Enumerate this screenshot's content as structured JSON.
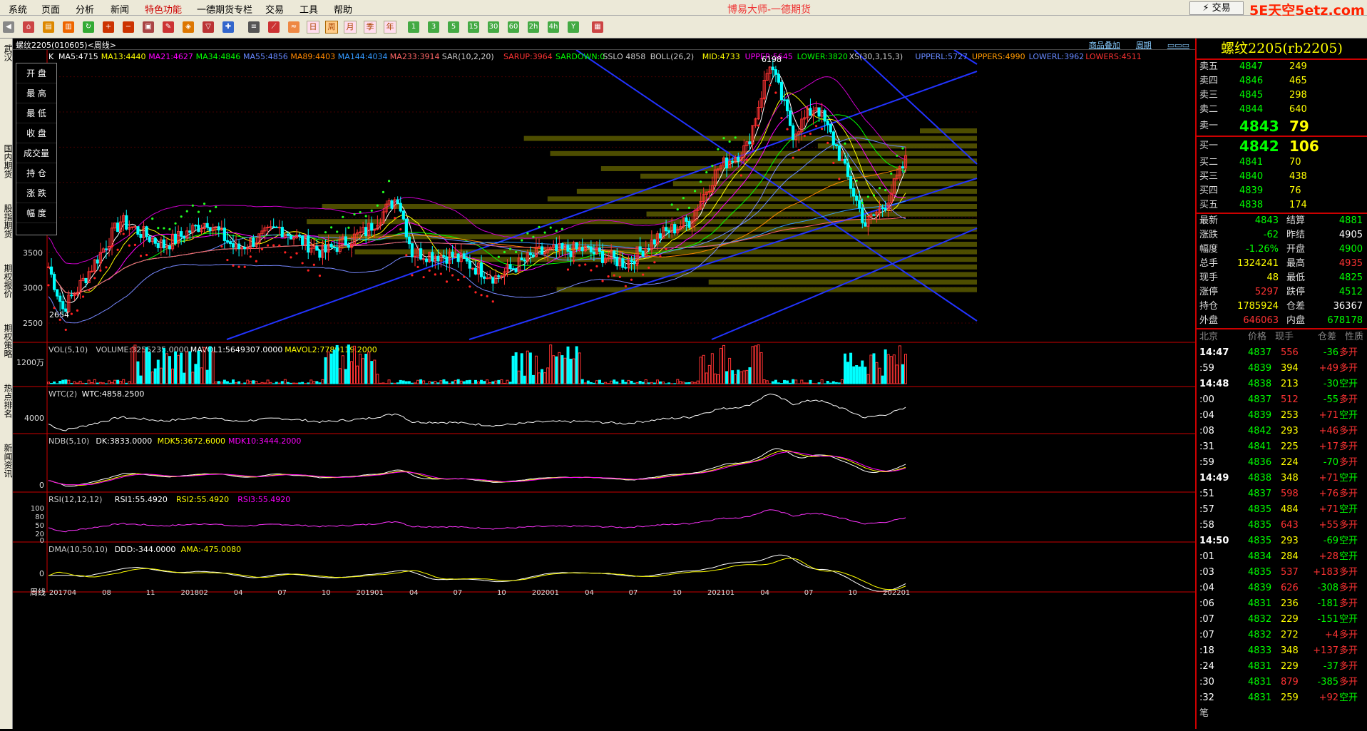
{
  "menu": {
    "items": [
      "系统",
      "页面",
      "分析",
      "新闻",
      "特色功能",
      "一德期货专栏",
      "交易",
      "工具",
      "帮助"
    ],
    "app_title": "博易大师-一德期货",
    "trade_button": "⚡ 交易",
    "logo": "5E天空5etz.com"
  },
  "left_tabs": [
    "武汉",
    "国内期货",
    "股指期货",
    "期权报价",
    "期权策略",
    "热点排名",
    "新闻资讯"
  ],
  "chart": {
    "title": "螺纹2205(010605)<周线>",
    "buttons": [
      "商品叠加",
      "周期"
    ],
    "main_indicator": {
      "label": "K",
      "items": [
        {
          "text": "MA5:4715",
          "color": "#ffffff"
        },
        {
          "text": "MA13:4440",
          "color": "#ffff00"
        },
        {
          "text": "MA21:4627",
          "color": "#ff00ff"
        },
        {
          "text": "MA34:4846",
          "color": "#00ff00"
        },
        {
          "text": "MA55:4856",
          "color": "#6688ff"
        },
        {
          "text": "MA89:4403",
          "color": "#ff8800"
        },
        {
          "text": "MA144:4034",
          "color": "#3399ff"
        },
        {
          "text": "MA233:3914",
          "color": "#ff6666"
        },
        {
          "text": "SAR(10,2,20)",
          "color": "#cccccc"
        },
        {
          "text": "SARUP:3964",
          "color": "#ff3333"
        },
        {
          "text": "SARDOWN:0",
          "color": "#00ff00"
        },
        {
          "text": "SSLO 4858",
          "color": "#cccccc"
        },
        {
          "text": "BOLL(26,2)",
          "color": "#cccccc"
        },
        {
          "text": "MID:4733",
          "color": "#ffff00"
        },
        {
          "text": "UPPER:5645",
          "color": "#ff00ff"
        },
        {
          "text": "LOWER:3820",
          "color": "#00ff00"
        },
        {
          "text": "XS(30,3,15,3)",
          "color": "#cccccc"
        },
        {
          "text": "UPPERL:5727",
          "color": "#6688ff"
        },
        {
          "text": "UPPERS:4990",
          "color": "#ff9900"
        },
        {
          "text": "LOWERL:3962",
          "color": "#6688ff"
        },
        {
          "text": "LOWERS:4511",
          "color": "#ff3333"
        }
      ]
    },
    "y_ticks": [
      "4000",
      "3500",
      "3000",
      "2500"
    ],
    "high_label": "6198",
    "low_label": "2654",
    "info_labels": [
      "开 盘",
      "最 高",
      "最 低",
      "收 盘",
      "成交量",
      "持 仓",
      "涨 跌",
      "幅 度"
    ],
    "vol": {
      "header": [
        {
          "text": "VOL(5,10)",
          "color": "#cccccc"
        },
        {
          "text": "VOLUME:3255235.0000",
          "color": "#cccccc"
        },
        {
          "text": "MAVOL1:5649307.0000",
          "color": "#ffffff"
        },
        {
          "text": "MAVOL2:7789119.2000",
          "color": "#ffff00"
        }
      ],
      "tick": "1200万"
    },
    "wtc": {
      "header": [
        {
          "text": "WTC(2)",
          "color": "#cccccc"
        },
        {
          "text": "WTC:4858.2500",
          "color": "#ffffff"
        }
      ],
      "tick": "4000"
    },
    "ndb": {
      "header": [
        {
          "text": "NDB(5,10)",
          "color": "#cccccc"
        },
        {
          "text": "DK:3833.0000",
          "color": "#ffffff"
        },
        {
          "text": "MDK5:3672.6000",
          "color": "#ffff00"
        },
        {
          "text": "MDK10:3444.2000",
          "color": "#ff00ff"
        }
      ],
      "tick": "0"
    },
    "rsi": {
      "header": [
        {
          "text": "RSI(12,12,12)",
          "color": "#cccccc"
        },
        {
          "text": "RSI1:55.4920",
          "color": "#ffffff"
        },
        {
          "text": "RSI2:55.4920",
          "color": "#ffff00"
        },
        {
          "text": "RSI3:55.4920",
          "color": "#ff00ff"
        }
      ],
      "ticks": [
        "100",
        "80",
        "50",
        "20",
        "0"
      ]
    },
    "dma": {
      "header": [
        {
          "text": "DMA(10,50,10)",
          "color": "#cccccc"
        },
        {
          "text": "DDD:-344.0000",
          "color": "#ffffff"
        },
        {
          "text": "AMA:-475.0080",
          "color": "#ffff00"
        }
      ],
      "tick": "0"
    },
    "x_axis": {
      "period_label": "周线",
      "ticks": [
        "201704",
        "08",
        "11",
        "201802",
        "04",
        "07",
        "10",
        "201901",
        "04",
        "07",
        "10",
        "202001",
        "04",
        "07",
        "10",
        "202101",
        "04",
        "07",
        "10",
        "202201"
      ]
    }
  },
  "quote": {
    "title": "螺纹2205(rb2205)",
    "asks": [
      {
        "label": "卖五",
        "price": "4847",
        "vol": "249"
      },
      {
        "label": "卖四",
        "price": "4846",
        "vol": "465"
      },
      {
        "label": "卖三",
        "price": "4845",
        "vol": "298"
      },
      {
        "label": "卖二",
        "price": "4844",
        "vol": "640"
      },
      {
        "label": "卖一",
        "price": "4843",
        "vol": "79"
      }
    ],
    "bids": [
      {
        "label": "买一",
        "price": "4842",
        "vol": "106"
      },
      {
        "label": "买二",
        "price": "4841",
        "vol": "70"
      },
      {
        "label": "买三",
        "price": "4840",
        "vol": "438"
      },
      {
        "label": "买四",
        "price": "4839",
        "vol": "76"
      },
      {
        "label": "买五",
        "price": "4838",
        "vol": "174"
      }
    ],
    "stats": [
      {
        "l1": "最新",
        "v1": "4843",
        "c1": "#00ff00",
        "l2": "结算",
        "v2": "4881",
        "c2": "#00ff00"
      },
      {
        "l1": "涨跌",
        "v1": "-62",
        "c1": "#00ff00",
        "l2": "昨结",
        "v2": "4905",
        "c2": "#ffffff"
      },
      {
        "l1": "幅度",
        "v1": "-1.26%",
        "c1": "#00ff00",
        "l2": "开盘",
        "v2": "4900",
        "c2": "#00ff00"
      },
      {
        "l1": "总手",
        "v1": "1324241",
        "c1": "#ffff00",
        "l2": "最高",
        "v2": "4935",
        "c2": "#ff3333"
      },
      {
        "l1": "现手",
        "v1": "48",
        "c1": "#ffff00",
        "l2": "最低",
        "v2": "4825",
        "c2": "#00ff00"
      },
      {
        "l1": "涨停",
        "v1": "5297",
        "c1": "#ff3333",
        "l2": "跌停",
        "v2": "4512",
        "c2": "#00ff00"
      },
      {
        "l1": "持仓",
        "v1": "1785924",
        "c1": "#ffff00",
        "l2": "仓差",
        "v2": "36367",
        "c2": "#ffffff"
      },
      {
        "l1": "外盘",
        "v1": "646063",
        "c1": "#ff3333",
        "l2": "内盘",
        "v2": "678178",
        "c2": "#00ff00"
      }
    ],
    "tick_header": [
      "北京",
      "价格",
      "现手",
      "仓差",
      "性质"
    ],
    "ticks": [
      {
        "t": "14:47",
        "p": "4837",
        "v": "556",
        "d": "-36",
        "n": "多开"
      },
      {
        "t": ":59",
        "p": "4839",
        "v": "394",
        "d": "+49",
        "n": "多开"
      },
      {
        "t": "14:48",
        "p": "4838",
        "v": "213",
        "d": "-30",
        "n": "空开"
      },
      {
        "t": ":00",
        "p": "4837",
        "v": "512",
        "d": "-55",
        "n": "多开"
      },
      {
        "t": ":04",
        "p": "4839",
        "v": "253",
        "d": "+71",
        "n": "空开"
      },
      {
        "t": ":08",
        "p": "4842",
        "v": "293",
        "d": "+46",
        "n": "多开"
      },
      {
        "t": ":31",
        "p": "4841",
        "v": "225",
        "d": "+17",
        "n": "多开"
      },
      {
        "t": ":59",
        "p": "4836",
        "v": "224",
        "d": "-70",
        "n": "多开"
      },
      {
        "t": "14:49",
        "p": "4838",
        "v": "348",
        "d": "+71",
        "n": "空开"
      },
      {
        "t": ":51",
        "p": "4837",
        "v": "598",
        "d": "+76",
        "n": "多开"
      },
      {
        "t": ":57",
        "p": "4835",
        "v": "484",
        "d": "+71",
        "n": "空开"
      },
      {
        "t": ":58",
        "p": "4835",
        "v": "643",
        "d": "+55",
        "n": "多开"
      },
      {
        "t": "14:50",
        "p": "4835",
        "v": "293",
        "d": "-69",
        "n": "空开"
      },
      {
        "t": ":01",
        "p": "4834",
        "v": "284",
        "d": "+28",
        "n": "空开"
      },
      {
        "t": ":03",
        "p": "4835",
        "v": "537",
        "d": "+183",
        "n": "多开"
      },
      {
        "t": ":04",
        "p": "4839",
        "v": "626",
        "d": "-308",
        "n": "多开"
      },
      {
        "t": ":06",
        "p": "4831",
        "v": "236",
        "d": "-181",
        "n": "多开"
      },
      {
        "t": ":07",
        "p": "4832",
        "v": "229",
        "d": "-151",
        "n": "空开"
      },
      {
        "t": ":07",
        "p": "4832",
        "v": "272",
        "d": "+4",
        "n": "多开"
      },
      {
        "t": ":18",
        "p": "4833",
        "v": "348",
        "d": "+137",
        "n": "多开"
      },
      {
        "t": ":24",
        "p": "4831",
        "v": "229",
        "d": "-37",
        "n": "多开"
      },
      {
        "t": ":30",
        "p": "4831",
        "v": "879",
        "d": "-385",
        "n": "多开"
      },
      {
        "t": ":32",
        "p": "4831",
        "v": "259",
        "d": "+92",
        "n": "空开"
      }
    ],
    "footer": "笔"
  }
}
